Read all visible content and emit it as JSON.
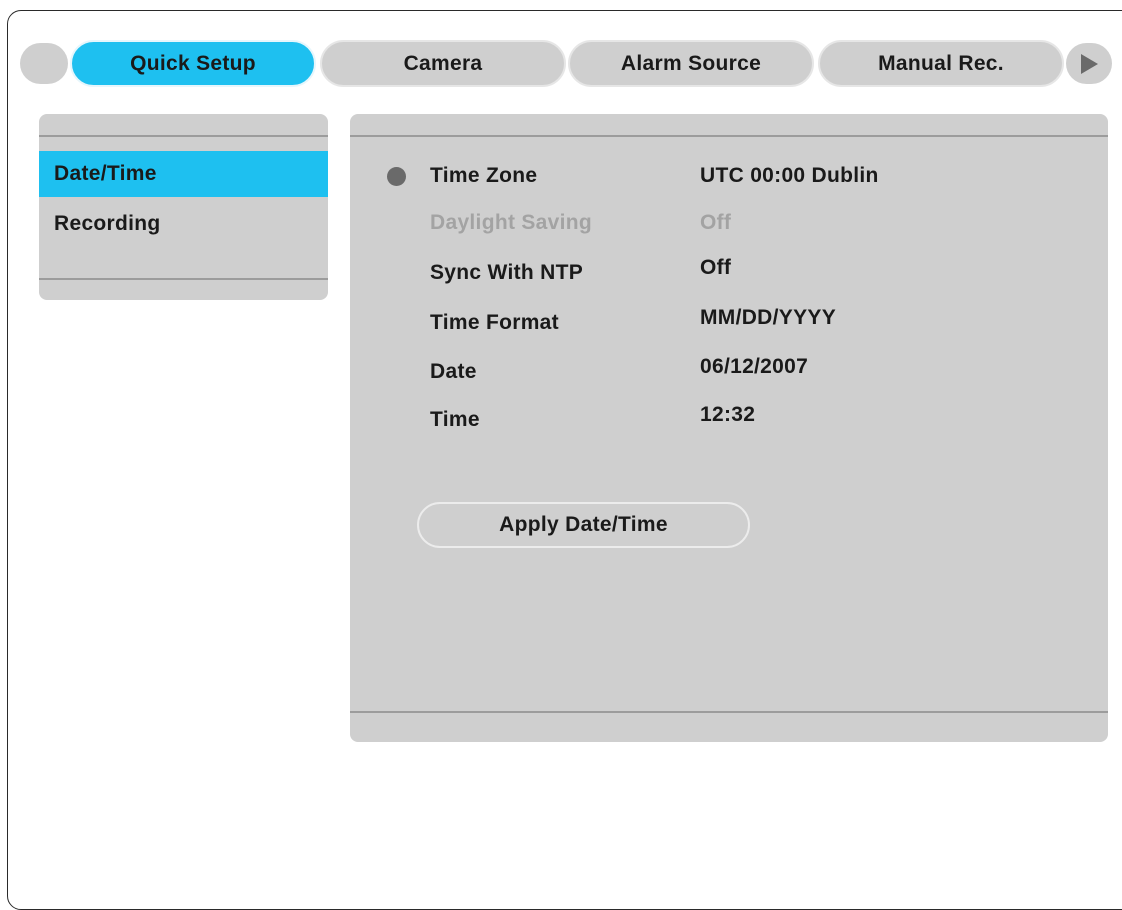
{
  "tabs": [
    {
      "label": "Quick Setup",
      "active": true
    },
    {
      "label": "Camera",
      "active": false
    },
    {
      "label": "Alarm Source",
      "active": false
    },
    {
      "label": "Manual Rec.",
      "active": false
    }
  ],
  "sidebar": {
    "items": [
      {
        "label": "Date/Time",
        "active": true
      },
      {
        "label": "Recording",
        "active": false
      }
    ]
  },
  "settings": {
    "time_zone": {
      "label": "Time Zone",
      "value": "UTC 00:00 Dublin"
    },
    "daylight_saving": {
      "label": "Daylight Saving",
      "value": "Off"
    },
    "sync_ntp": {
      "label": "Sync With NTP",
      "value": "Off"
    },
    "time_format": {
      "label": "Time Format",
      "value": "MM/DD/YYYY"
    },
    "date": {
      "label": "Date",
      "value": "06/12/2007"
    },
    "time": {
      "label": "Time",
      "value": "12:32"
    }
  },
  "apply_button": {
    "label": "Apply Date/Time"
  },
  "colors": {
    "accent": "#1ec0f0",
    "panel": "#cfcfcf",
    "disabled_text": "#a3a3a3",
    "bullet": "#6a6a6a"
  },
  "icons": {
    "tab_edge": "circle",
    "next_tab": "play-triangle-right-icon",
    "selection_bullet": "filled-circle-icon"
  }
}
